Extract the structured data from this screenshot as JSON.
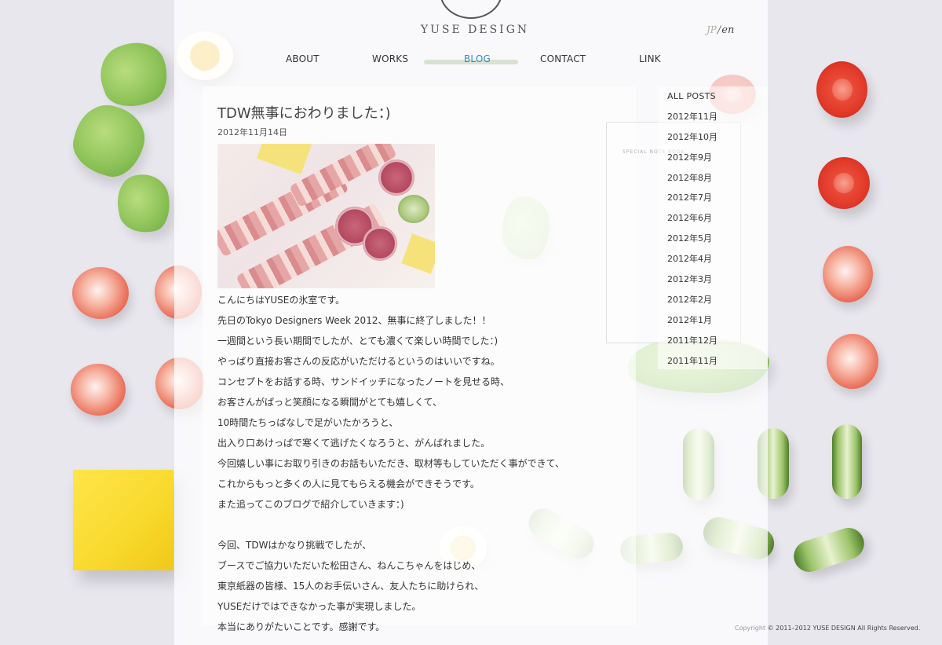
{
  "site": {
    "brand": "YUSE DESIGN",
    "lang_jp": "JP",
    "lang_sep": "/",
    "lang_en": "en"
  },
  "nav": {
    "items": [
      {
        "label": "ABOUT",
        "active": false
      },
      {
        "label": "WORKS",
        "active": false
      },
      {
        "label": "BLOG",
        "active": true
      },
      {
        "label": "CONTACT",
        "active": false
      },
      {
        "label": "LINK",
        "active": false
      }
    ],
    "active_color": "#2c8ccd"
  },
  "post": {
    "title": "TDW無事におわりました：)",
    "date": "2012年11月14日",
    "paragraphs": [
      "こんにちはYUSEの氷室です。",
      "先日のTokyo Designers Week 2012、無事に終了しました！！",
      "一週間という長い期間でしたが、とても濃くて楽しい時間でした：)",
      "やっぱり直接お客さんの反応がいただけるというのはいいですね。",
      "コンセプトをお話する時、サンドイッチになったノートを見せる時、",
      "お客さんがぱっと笑顔になる瞬間がとても嬉しくて、",
      "10時間たちっぱなしで足がいたかろうと、",
      "出入り口あけっぱで寒くて逃げたくなろうと、がんばれました。",
      "今回嬉しい事にお取り引きのお話もいただき、取材等もしていただく事ができて、",
      "これからもっと多くの人に見てもらえる機会ができそうです。",
      "また追ってこのブログで紹介していきます：)",
      "",
      "今回、TDWはかなり挑戦でしたが、",
      "ブースでご協力いただいた松田さん、ねんこちゃんをはじめ、",
      "東京紙器の皆様、15人のお手伝いさん、友人たちに助けられ、",
      "YUSEだけではできなかった事が実現しました。",
      "本当にありがたいことです。感謝です。"
    ]
  },
  "archive": {
    "items": [
      "ALL POSTS",
      "2012年11月",
      "2012年10月",
      "2012年9月",
      "2012年8月",
      "2012年7月",
      "2012年6月",
      "2012年5月",
      "2012年4月",
      "2012年3月",
      "2012年2月",
      "2012年1月",
      "2011年12月",
      "2011年11月"
    ]
  },
  "notebook": {
    "label": "SPECIAL NOTE BOOK"
  },
  "footer": {
    "copyright_word": "Copyright",
    "copyright_text": "© 2011–2012 YUSE DESIGN All Rights Reserved."
  }
}
